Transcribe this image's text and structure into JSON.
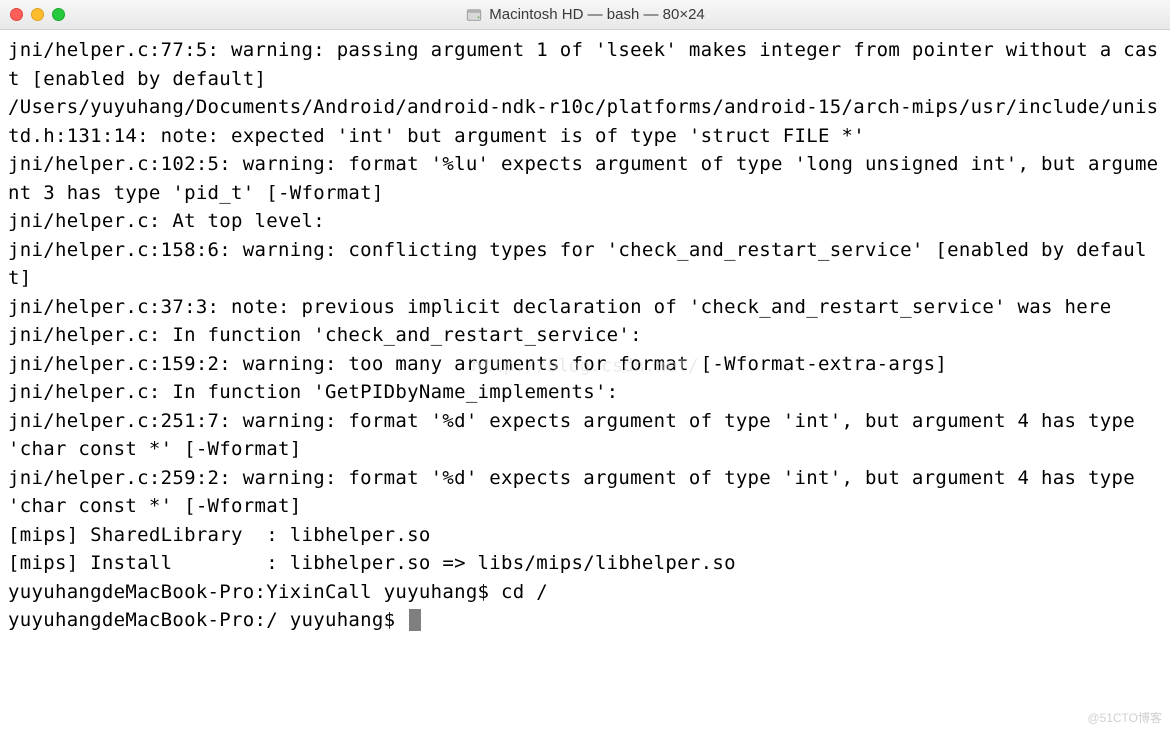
{
  "window": {
    "title": "Macintosh HD — bash — 80×24"
  },
  "terminal": {
    "lines": [
      "jni/helper.c:77:5: warning: passing argument 1 of 'lseek' makes integer from pointer without a cast [enabled by default]",
      "/Users/yuyuhang/Documents/Android/android-ndk-r10c/platforms/android-15/arch-mips/usr/include/unistd.h:131:14: note: expected 'int' but argument is of type 'struct FILE *'",
      "jni/helper.c:102:5: warning: format '%lu' expects argument of type 'long unsigned int', but argument 3 has type 'pid_t' [-Wformat]",
      "jni/helper.c: At top level:",
      "jni/helper.c:158:6: warning: conflicting types for 'check_and_restart_service' [enabled by default]",
      "jni/helper.c:37:3: note: previous implicit declaration of 'check_and_restart_service' was here",
      "jni/helper.c: In function 'check_and_restart_service':",
      "jni/helper.c:159:2: warning: too many arguments for format [-Wformat-extra-args]",
      "jni/helper.c: In function 'GetPIDbyName_implements':",
      "jni/helper.c:251:7: warning: format '%d' expects argument of type 'int', but argument 4 has type 'char const *' [-Wformat]",
      "jni/helper.c:259:2: warning: format '%d' expects argument of type 'int', but argument 4 has type 'char const *' [-Wformat]",
      "[mips] SharedLibrary  : libhelper.so",
      "[mips] Install        : libhelper.so => libs/mips/libhelper.so",
      "yuyuhangdeMacBook-Pro:YixinCall yuyuhang$ cd /"
    ],
    "current_prompt": "yuyuhangdeMacBook-Pro:/ yuyuhang$ ",
    "current_input": ""
  },
  "watermark_center": "http://blog.csdn.net/",
  "watermark_bottom": "@51CTO博客"
}
